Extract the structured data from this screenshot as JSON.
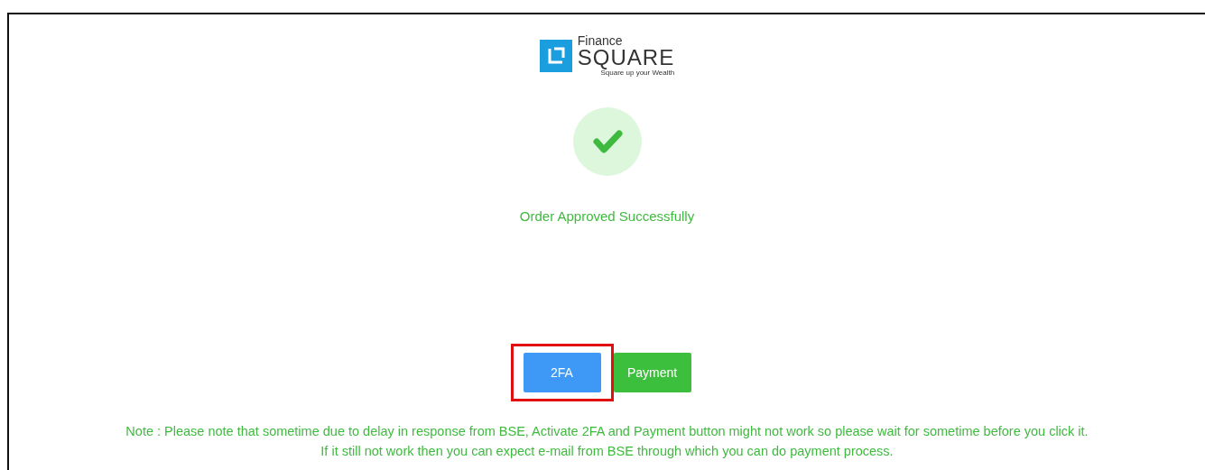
{
  "logo": {
    "line_1": "Finance",
    "line_2": "SQUARE",
    "tagline": "Square up your Wealth"
  },
  "status": {
    "message": "Order Approved Successfully"
  },
  "buttons": [
    {
      "label": "2FA",
      "kind": "primary",
      "highlighted": true
    },
    {
      "label": "Payment",
      "kind": "success",
      "highlighted": false
    }
  ],
  "note": [
    "Note : Please note that sometime due to delay in response from BSE, Activate 2FA and Payment button might not work so please wait for sometime before you click it.",
    "If it still not work then you can expect e-mail from BSE through which you can do payment process."
  ]
}
